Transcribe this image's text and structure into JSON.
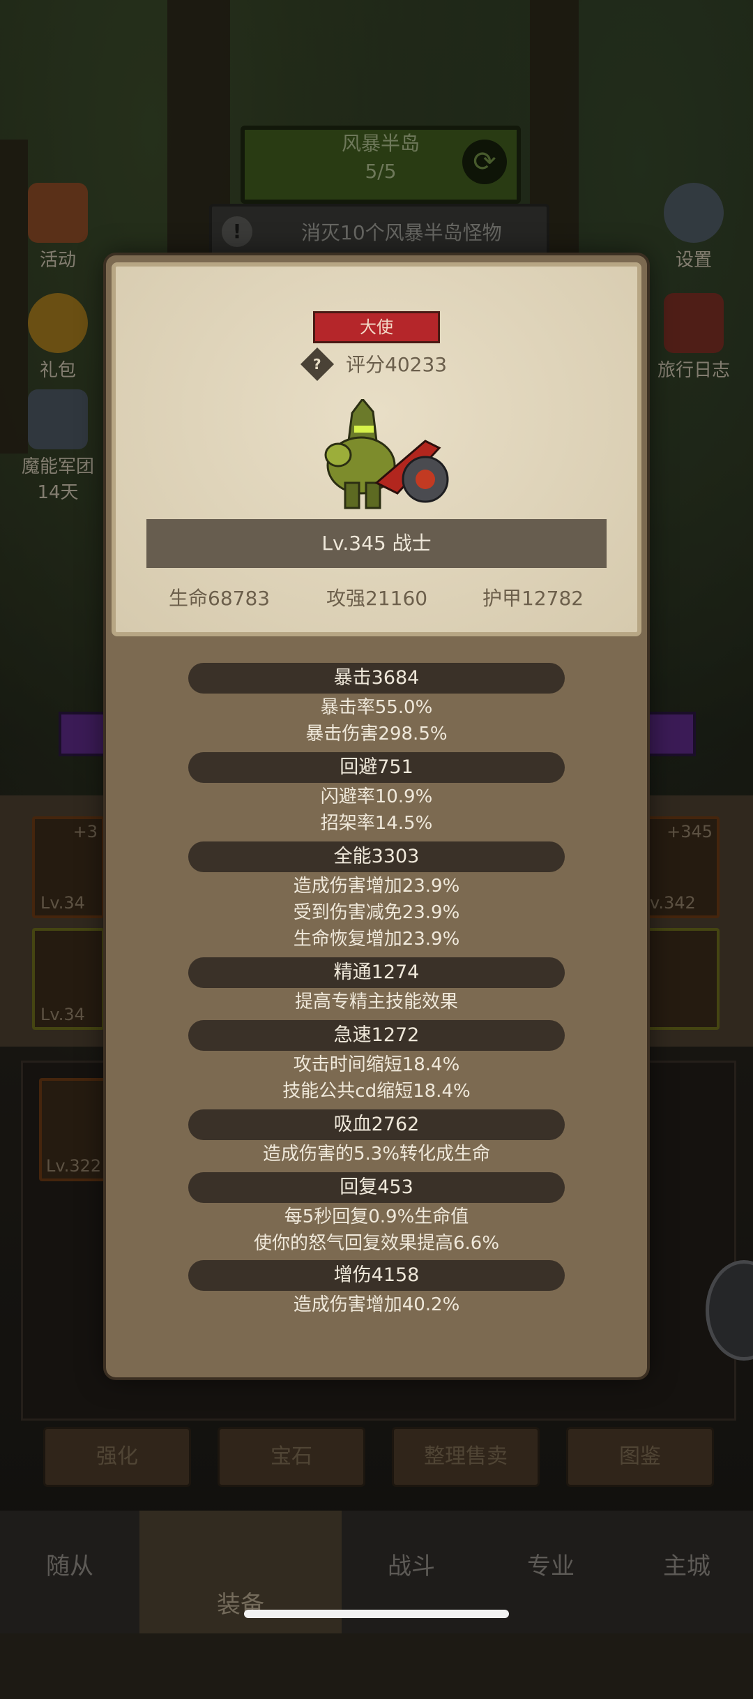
{
  "stage": {
    "name": "风暴半岛",
    "progress": "5/5"
  },
  "quest": {
    "text": "消灭10个风暴半岛怪物"
  },
  "left_menu": [
    {
      "label": "活动"
    },
    {
      "label": "礼包"
    },
    {
      "label": "魔能军团",
      "sub": "14天"
    }
  ],
  "right_menu": [
    {
      "label": "设置"
    },
    {
      "label": "旅行日志"
    }
  ],
  "equipment_slots": {
    "left_top": {
      "plus": "+3",
      "level": "Lv.34"
    },
    "left_mid": {
      "level": "Lv.34"
    },
    "left_bottom": {
      "level": "Lv.322"
    },
    "right_top": {
      "plus": "+345",
      "level": "v.342"
    }
  },
  "bottom_tabs": [
    "强化",
    "宝石",
    "整理售卖",
    "图鉴"
  ],
  "nav": [
    "随从",
    "装备",
    "战斗",
    "专业",
    "主城"
  ],
  "character": {
    "rank": "大使",
    "score": "评分40233",
    "banner": "Lv.345 战士",
    "hp": "生命68783",
    "attack": "攻强21160",
    "armor": "护甲12782"
  },
  "stats": [
    {
      "title": "暴击3684",
      "lines": [
        "暴击率55.0%",
        "暴击伤害298.5%"
      ]
    },
    {
      "title": "回避751",
      "lines": [
        "闪避率10.9%",
        "招架率14.5%"
      ]
    },
    {
      "title": "全能3303",
      "lines": [
        "造成伤害增加23.9%",
        "受到伤害减免23.9%",
        "生命恢复增加23.9%"
      ]
    },
    {
      "title": "精通1274",
      "lines": [
        "提高专精主技能效果"
      ]
    },
    {
      "title": "急速1272",
      "lines": [
        "攻击时间缩短18.4%",
        "技能公共cd缩短18.4%"
      ]
    },
    {
      "title": "吸血2762",
      "lines": [
        "造成伤害的5.3%转化成生命"
      ]
    },
    {
      "title": "回复453",
      "lines": [
        "每5秒回复0.9%生命值",
        "使你的怒气回复效果提高6.6%"
      ]
    },
    {
      "title": "增伤4158",
      "lines": [
        "造成伤害增加40.2%"
      ]
    }
  ],
  "colors": {
    "rank_badge": "#b5262a",
    "modal_bg": "#7c6a51",
    "parchment": "#dcd1b6"
  }
}
